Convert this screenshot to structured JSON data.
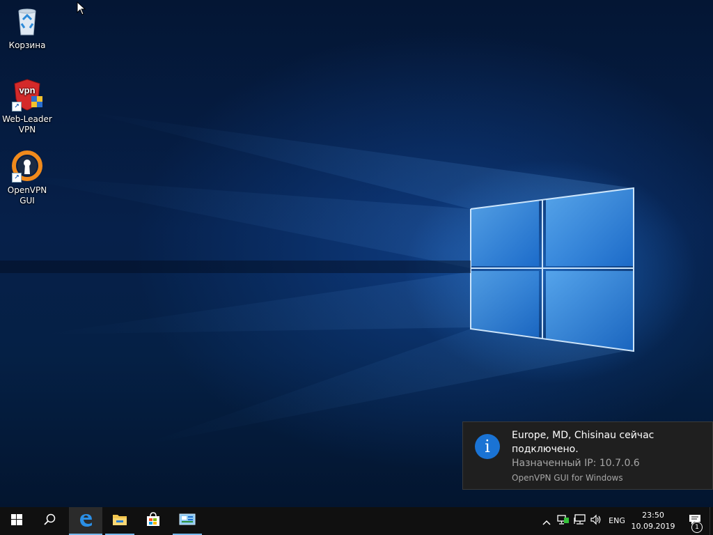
{
  "desktop": {
    "icons": [
      {
        "label": "Корзина",
        "icon": "recycle-bin-icon"
      },
      {
        "label": "Web-Leader VPN",
        "icon": "vpn-shield-icon",
        "badge_text": "vpn"
      },
      {
        "label": "OpenVPN GUI",
        "icon": "openvpn-icon"
      }
    ],
    "wallpaper": "windows-10-hero"
  },
  "notification": {
    "title": "Europe, MD, Chisinau сейчас подключено.",
    "body": "Назначенный IP: 10.7.0.6",
    "source": "OpenVPN GUI for Windows",
    "icon": "info-icon",
    "icon_glyph": "i"
  },
  "taskbar": {
    "buttons": [
      {
        "name": "start",
        "icon": "windows-logo-icon"
      },
      {
        "name": "search",
        "icon": "search-icon"
      },
      {
        "name": "edge",
        "icon": "edge-icon",
        "active": true
      },
      {
        "name": "file-explorer",
        "icon": "folder-icon"
      },
      {
        "name": "store",
        "icon": "store-icon"
      },
      {
        "name": "control-panel",
        "icon": "control-panel-icon"
      }
    ],
    "tray": {
      "icons": [
        "chevron-up-icon",
        "openvpn-tray-icon",
        "network-icon",
        "volume-icon"
      ],
      "language": "ENG",
      "time": "23:50",
      "date": "10.09.2019",
      "notification_count": "1"
    }
  },
  "colors": {
    "accent": "#76b9ed",
    "info_blue": "#1a73d4",
    "taskbar": "#101010",
    "toast_bg": "#1f1f1f"
  }
}
